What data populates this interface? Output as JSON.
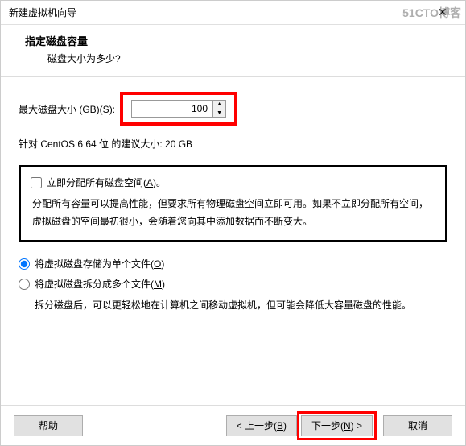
{
  "watermark": "51CTO博客",
  "titlebar": {
    "text": "新建虚拟机向导"
  },
  "header": {
    "title": "指定磁盘容量",
    "sub": "磁盘大小为多少?"
  },
  "size": {
    "label_pre": "最大磁盘大小 (GB)(",
    "label_key": "S",
    "label_post": "):",
    "value": "100"
  },
  "recommend": "针对 CentOS 6 64 位 的建议大小: 20 GB",
  "alloc": {
    "checkbox_pre": "立即分配所有磁盘空间(",
    "checkbox_key": "A",
    "checkbox_post": ")。",
    "desc": "分配所有容量可以提高性能，但要求所有物理磁盘空间立即可用。如果不立即分配所有空间，虚拟磁盘的空间最初很小，会随着您向其中添加数据而不断变大。"
  },
  "store": {
    "single_pre": "将虚拟磁盘存储为单个文件(",
    "single_key": "O",
    "single_post": ")",
    "split_pre": "将虚拟磁盘拆分成多个文件(",
    "split_key": "M",
    "split_post": ")",
    "split_desc": "拆分磁盘后，可以更轻松地在计算机之间移动虚拟机，但可能会降低大容量磁盘的性能。"
  },
  "footer": {
    "help": "帮助",
    "back_pre": "< 上一步(",
    "back_key": "B",
    "back_post": ")",
    "next_pre": "下一步(",
    "next_key": "N",
    "next_post": ") >",
    "cancel": "取消"
  }
}
